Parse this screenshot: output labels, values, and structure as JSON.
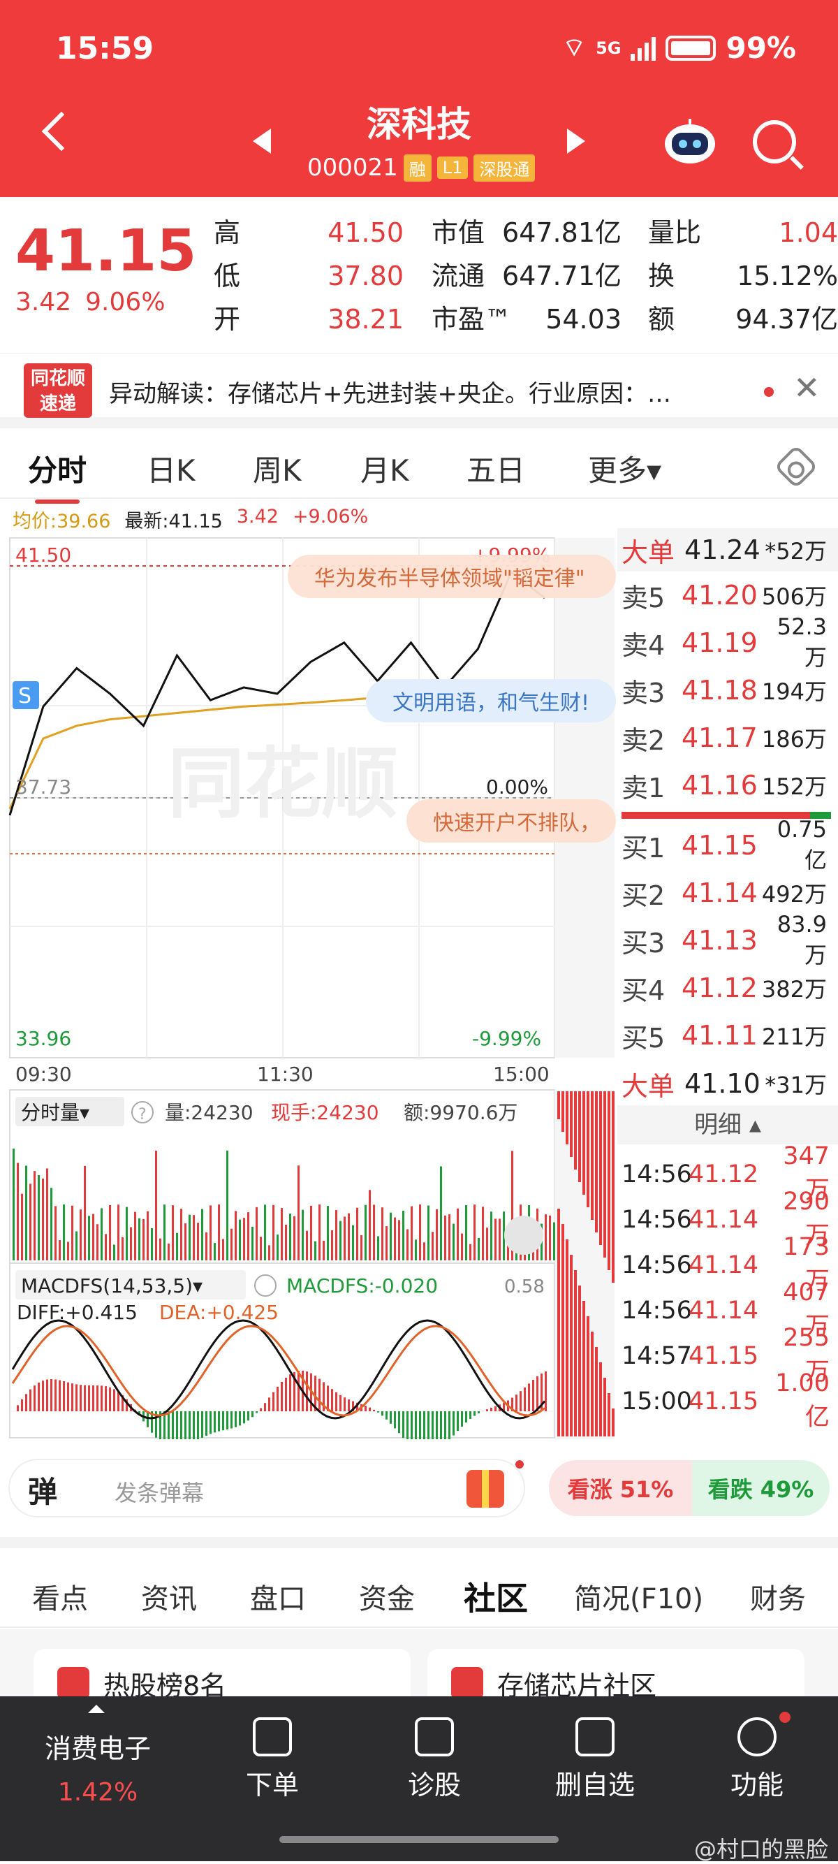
{
  "status": {
    "time": "15:59",
    "network": "5G",
    "battery": "99%"
  },
  "header": {
    "name": "深科技",
    "code": "000021",
    "tags": [
      "融",
      "L1",
      "深股通"
    ]
  },
  "quote": {
    "price": "41.15",
    "change": "3.42",
    "change_pct": "9.06%",
    "col1": [
      [
        "高",
        "41.50"
      ],
      [
        "低",
        "37.80"
      ],
      [
        "开",
        "38.21"
      ]
    ],
    "col2": [
      [
        "市值",
        "647.81亿"
      ],
      [
        "流通",
        "647.71亿"
      ],
      [
        "市盈™",
        "54.03"
      ]
    ],
    "col3": [
      [
        "量比",
        "1.04"
      ],
      [
        "换",
        "15.12%"
      ],
      [
        "额",
        "94.37亿"
      ]
    ]
  },
  "alert": {
    "logo_line1": "同花顺",
    "logo_line2": "速递",
    "text": "异动解读：存储芯片+先进封装+央企。行业原因：…"
  },
  "period_tabs": [
    "分时",
    "日K",
    "周K",
    "月K",
    "五日",
    "更多▾"
  ],
  "chart_info": {
    "avg_label": "均价:39.66",
    "latest_label": "最新:41.15",
    "change": "3.42",
    "change_pct": "+9.06%"
  },
  "chart": {
    "top_price": "41.50",
    "mid_price": "37.73",
    "low_price": "33.96",
    "top_pct": "+9.99%",
    "mid_pct": "0.00%",
    "low_pct": "-9.99%",
    "times": [
      "09:30",
      "11:30",
      "15:00"
    ],
    "banners": [
      "华为发布半导体领域\"韬定律\"",
      "文明用语，和气生财!",
      "快速开户不排队，"
    ],
    "watermark": "同花顺",
    "volume_label": "分时量▾",
    "volume_value": "量:24230",
    "volume_hand": "现手:24230",
    "volume_amount": "额:9970.6万",
    "macd_label": "MACDFS(14,53,5)▾",
    "macd_value": "MACDFS:-0.020",
    "diff": "DIFF:+0.415",
    "dea": "DEA:+0.425",
    "macd_top": "0.58"
  },
  "chart_data": {
    "type": "line",
    "title": "",
    "x": [
      "09:30",
      "11:30",
      "15:00"
    ],
    "ylim": [
      33.96,
      41.5
    ],
    "series": [
      {
        "values": [
          37.6,
          39.3,
          39.9,
          39.5,
          39.0,
          40.1,
          39.4,
          39.6,
          39.5,
          40.0,
          40.3,
          39.7,
          40.3,
          39.6,
          40.2,
          41.4,
          41.0
        ]
      },
      {
        "values": [
          37.7,
          38.8,
          39.0,
          39.1,
          39.15,
          39.2,
          39.25,
          39.3,
          39.33,
          39.36,
          39.4,
          39.44,
          39.5,
          39.55,
          39.6,
          39.63,
          39.66
        ]
      }
    ]
  },
  "orderbook": {
    "big_top": {
      "label": "大单",
      "price": "41.24",
      "vol": "*52万"
    },
    "asks": [
      [
        "卖5",
        "41.20",
        "506万"
      ],
      [
        "卖4",
        "41.19",
        "52.3万"
      ],
      [
        "卖3",
        "41.18",
        "194万"
      ],
      [
        "卖2",
        "41.17",
        "186万"
      ],
      [
        "卖1",
        "41.16",
        "152万"
      ]
    ],
    "bids": [
      [
        "买1",
        "41.15",
        "0.75亿"
      ],
      [
        "买2",
        "41.14",
        "492万"
      ],
      [
        "买3",
        "41.13",
        "83.9万"
      ],
      [
        "买4",
        "41.12",
        "382万"
      ],
      [
        "买5",
        "41.11",
        "211万"
      ]
    ],
    "big_bottom": {
      "label": "大单",
      "price": "41.10",
      "vol": "*31万"
    },
    "detail_header": "明细 ▴",
    "trades": [
      [
        "14:56",
        "41.12",
        "347万"
      ],
      [
        "14:56",
        "41.14",
        "290万"
      ],
      [
        "14:56",
        "41.14",
        "173万"
      ],
      [
        "14:56",
        "41.14",
        "407万"
      ],
      [
        "14:57",
        "41.15",
        "255万"
      ],
      [
        "15:00",
        "41.15",
        "1.00亿"
      ]
    ]
  },
  "danmaku": {
    "icon": "弹",
    "placeholder": "发条弹幕"
  },
  "vote": {
    "up": "看涨 51%",
    "down": "看跌 49%"
  },
  "section_tabs": [
    "看点",
    "资讯",
    "盘口",
    "资金",
    "社区",
    "简况(F10)",
    "财务"
  ],
  "cards": [
    "热股榜8名",
    "存储芯片社区"
  ],
  "bottom_nav": {
    "sector": "消费电子",
    "sector_pct": "1.42%",
    "items": [
      "下单",
      "诊股",
      "删自选",
      "功能"
    ]
  },
  "watermark": "@村口的黑脸",
  "colors": {
    "up": "#e33b3b",
    "down": "#1f9a3a",
    "header": "#ef3b3b",
    "avg_line": "#e0a020"
  }
}
